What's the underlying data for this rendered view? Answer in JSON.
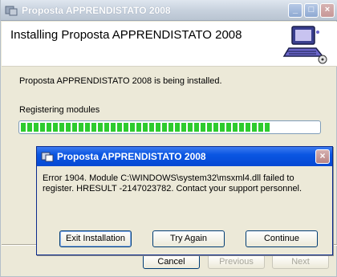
{
  "installer": {
    "title": "Proposta APPRENDISTATO 2008",
    "heading": "Installing Proposta APPRENDISTATO 2008",
    "status": "Proposta APPRENDISTATO 2008 is being installed.",
    "action": "Registering modules",
    "progress": 0.84,
    "buttons": {
      "cancel": "Cancel",
      "previous": "Previous",
      "next": "Next"
    }
  },
  "error_dialog": {
    "title": "Proposta APPRENDISTATO 2008",
    "message": "Error 1904. Module C:\\WINDOWS\\system32\\msxml4.dll failed to register.  HRESULT -2147023782.  Contact your support personnel.",
    "buttons": {
      "exit": "Exit Installation",
      "retry": "Try Again",
      "continue": "Continue"
    }
  },
  "colors": {
    "progress": "#2ecb2e",
    "dialog_title": "#0548d3"
  },
  "icons": [
    "installer-app-icon",
    "minimize-icon",
    "maximize-icon",
    "close-icon",
    "computer-setup-icon",
    "dialog-app-icon",
    "dialog-close-icon"
  ]
}
